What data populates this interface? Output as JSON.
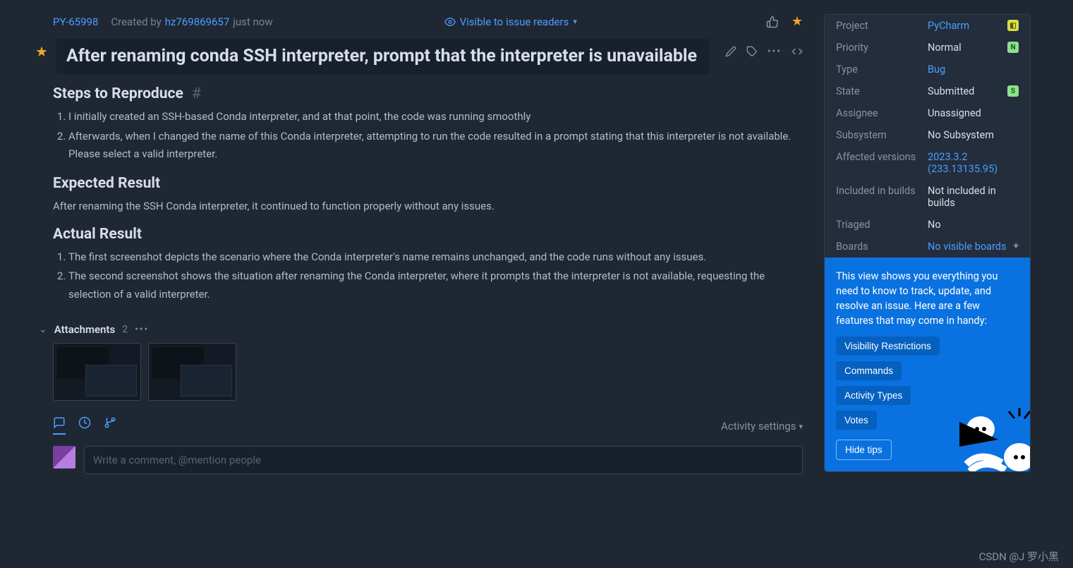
{
  "header": {
    "issue_id": "PY-65998",
    "created_by_prefix": "Created by",
    "author": "hz769869657",
    "time": "just now",
    "visibility": "Visible to issue readers"
  },
  "title": "After renaming conda SSH interpreter, prompt that the interpreter is unavailable",
  "sections": {
    "steps_heading": "Steps to Reproduce",
    "steps": [
      "I initially created an SSH-based Conda interpreter, and at that point, the code was running smoothly",
      "Afterwards, when I changed the name of this Conda interpreter, attempting to run the code resulted in a prompt stating that this interpreter is not available. Please select a valid interpreter."
    ],
    "expected_heading": "Expected Result",
    "expected_text": "After renaming the SSH Conda interpreter, it continued to function properly without any issues.",
    "actual_heading": "Actual Result",
    "actual": [
      "The first screenshot depicts the scenario where the Conda interpreter's name remains unchanged, and the code runs without any issues.",
      "The second screenshot shows the situation after renaming the Conda interpreter, where it prompts that the interpreter is not available, requesting the selection of a valid interpreter."
    ]
  },
  "attachments": {
    "label": "Attachments",
    "count": "2"
  },
  "activity": {
    "settings": "Activity settings"
  },
  "comment": {
    "placeholder": "Write a comment, @mention people"
  },
  "fields": {
    "project": {
      "label": "Project",
      "value": "PyCharm"
    },
    "priority": {
      "label": "Priority",
      "value": "Normal",
      "badge": "N"
    },
    "type": {
      "label": "Type",
      "value": "Bug"
    },
    "state": {
      "label": "State",
      "value": "Submitted",
      "badge": "S"
    },
    "assignee": {
      "label": "Assignee",
      "value": "Unassigned"
    },
    "subsystem": {
      "label": "Subsystem",
      "value": "No Subsystem"
    },
    "affected": {
      "label": "Affected versions",
      "value": "2023.3.2 (233.13135.95)"
    },
    "included": {
      "label": "Included in builds",
      "value": "Not included in builds"
    },
    "triaged": {
      "label": "Triaged",
      "value": "No"
    },
    "boards": {
      "label": "Boards",
      "value": "No visible boards"
    }
  },
  "tips": {
    "text": "This view shows you everything you need to know to track, update, and resolve an issue. Here are a few features that may come in handy:",
    "buttons": [
      "Visibility Restrictions",
      "Commands",
      "Activity Types",
      "Votes"
    ],
    "hide": "Hide tips"
  },
  "watermark": "CSDN @J 罗小黑"
}
